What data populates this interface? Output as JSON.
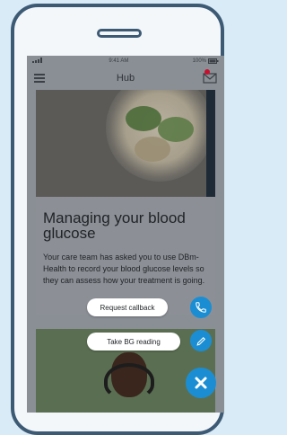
{
  "status": {
    "time": "9:41 AM",
    "battery": "100%"
  },
  "header": {
    "title": "Hub"
  },
  "article": {
    "title": "Managing your blood glucose",
    "text": "Your care team has asked you to use DBm-Health to record your blood glucose levels so they can assess how your treatment is going."
  },
  "actions": {
    "callback_label": "Request callback",
    "reading_label": "Take BG reading"
  },
  "icons": {
    "menu": "menu-icon",
    "mail": "mail-icon",
    "phone": "phone-icon",
    "pencil": "pencil-icon",
    "close": "close-icon"
  },
  "colors": {
    "accent": "#1b8ed3",
    "frame": "#3d5a75",
    "background": "#d9ebf6",
    "notification": "#c8102e"
  }
}
